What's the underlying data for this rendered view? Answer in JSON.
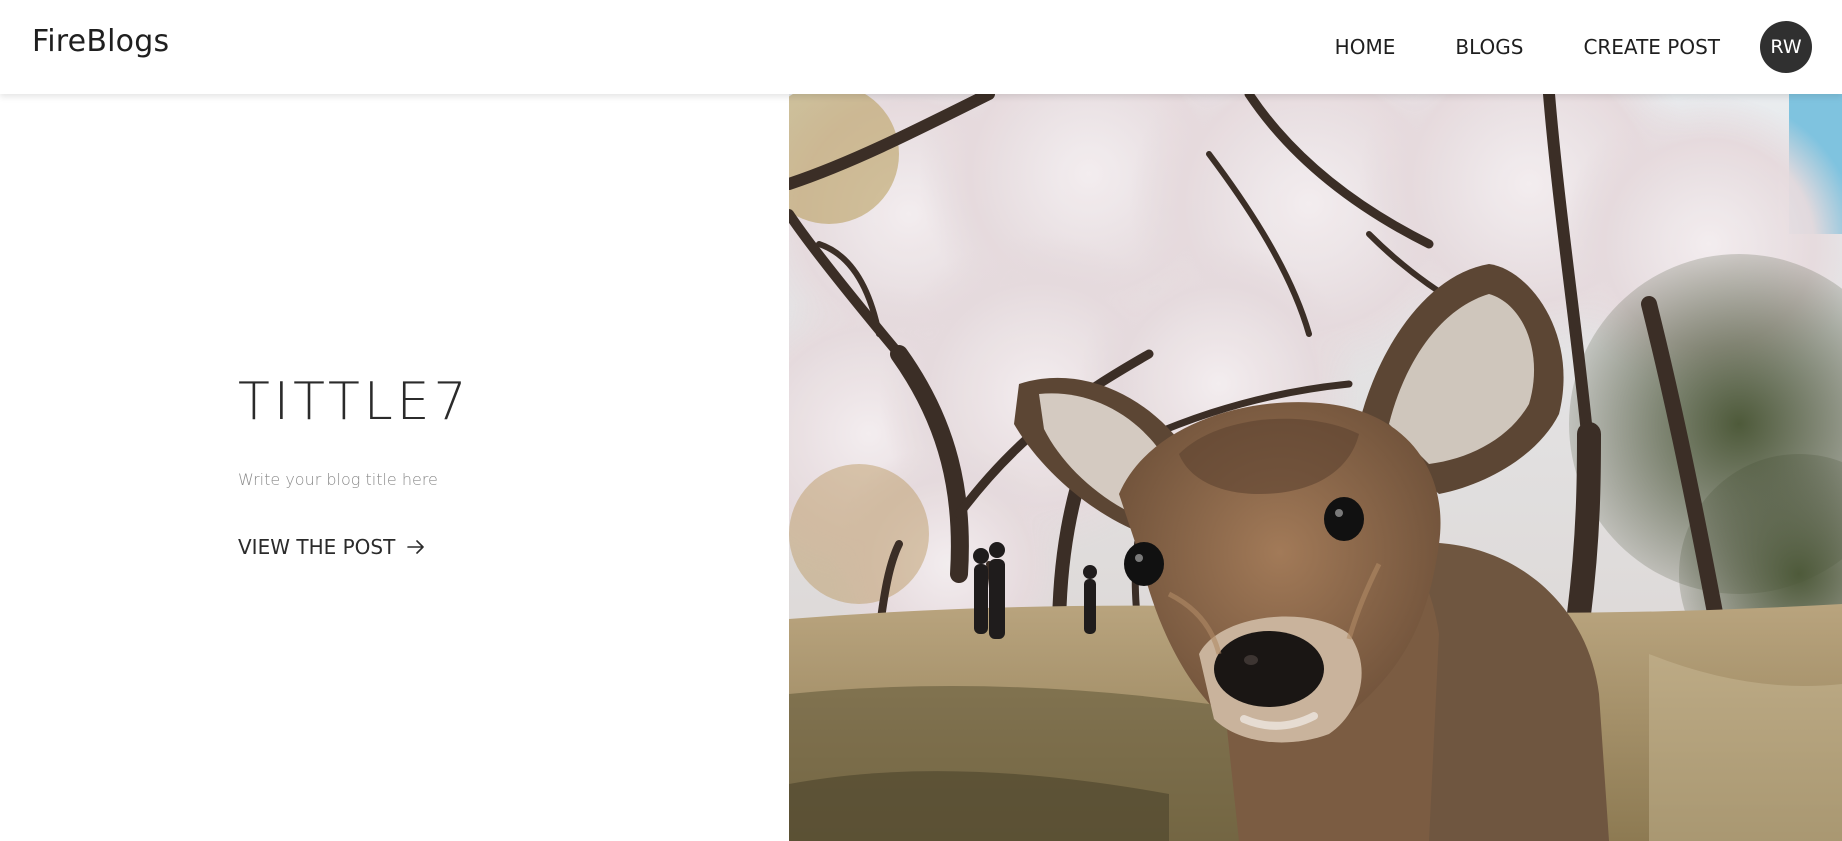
{
  "header": {
    "brand": "FireBlogs",
    "nav": [
      {
        "label": "HOME"
      },
      {
        "label": "BLOGS"
      },
      {
        "label": "CREATE POST"
      }
    ],
    "avatar_initials": "RW"
  },
  "hero": {
    "title": "TITTLE7",
    "description": "Write your blog title here",
    "cta_label": "VIEW THE POST",
    "cta_icon": "arrow-right-icon",
    "photo_subject": "deer-in-cherry-blossom-park-photo"
  },
  "colors": {
    "header_bg": "#ffffff",
    "avatar_bg": "#303030",
    "text_primary": "#2b2b2b",
    "text_muted": "#8a8a8a"
  }
}
